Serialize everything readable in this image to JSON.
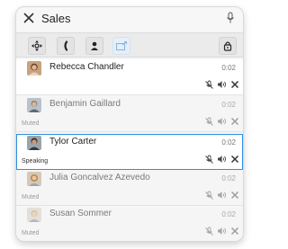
{
  "header": {
    "title": "Sales"
  },
  "participants": [
    {
      "name": "Rebecca Chandler",
      "duration": "0:02",
      "status": ""
    },
    {
      "name": "Benjamin Gaillard",
      "duration": "0:02",
      "status": "Muted"
    },
    {
      "name": "Tylor Carter",
      "duration": "0:02",
      "status": "Speaking"
    },
    {
      "name": "Julia Goncalvez Azevedo",
      "duration": "0:02",
      "status": "Muted"
    },
    {
      "name": "Susan Sommer",
      "duration": "0:02",
      "status": "Muted"
    }
  ],
  "colors": {
    "accent": "#2e8fe0",
    "text": "#222222",
    "muted_text": "#9a9a9a"
  }
}
